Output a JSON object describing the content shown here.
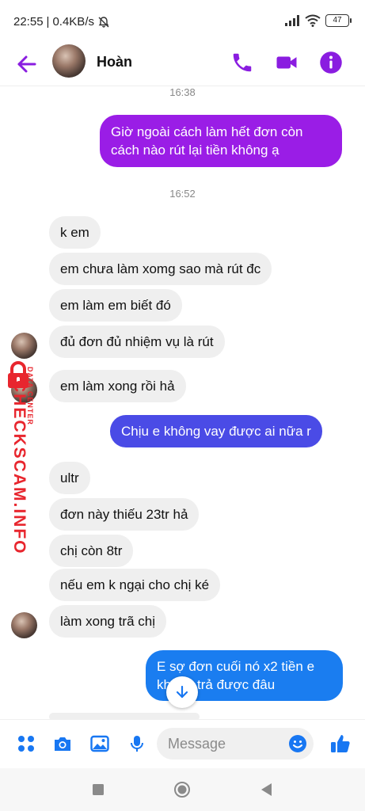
{
  "status_bar": {
    "time": "22:55",
    "speed": "0.4KB/s",
    "battery": "47"
  },
  "header": {
    "contact_name": "Hoàn"
  },
  "messages": {
    "time_1": "16:38",
    "out_1": "Giờ ngoài cách làm hết đơn còn cách nào rút lại tiền không ạ",
    "time_2": "16:52",
    "in_1": "k em",
    "in_2": "em chưa làm xomg sao mà rút đc",
    "in_3": "em làm em biết đó",
    "in_4": "đủ đơn đủ nhiệm vụ là rút",
    "in_5": "em làm xong rồi hả",
    "out_2": "Chịu e không vay được ai nữa r",
    "in_6": "ultr",
    "in_7": "đơn này thiếu 23tr hả",
    "in_8": "chị còn 8tr",
    "in_9": "nếu em k ngại cho chị ké",
    "in_10": "làm xong trã chị",
    "out_3": "E sợ đơn cuối nó x2 tiền e không trả được đâu"
  },
  "watermark": {
    "main": "CHECKSCAM.INFO",
    "sub": "DATA CENTER"
  },
  "composer": {
    "placeholder": "Message"
  },
  "colors": {
    "accent_purple": "#9a1de6",
    "bubble_indigo": "#4a4be6",
    "bubble_blue": "#1a7df0",
    "composer_blue": "#1877f2",
    "incoming_bg": "#efefef"
  },
  "icons": [
    "back-arrow-icon",
    "phone-icon",
    "video-camera-icon",
    "info-icon",
    "apps-grid-icon",
    "camera-icon",
    "image-icon",
    "microphone-icon",
    "emoji-icon",
    "thumbs-up-icon",
    "arrow-down-icon"
  ]
}
